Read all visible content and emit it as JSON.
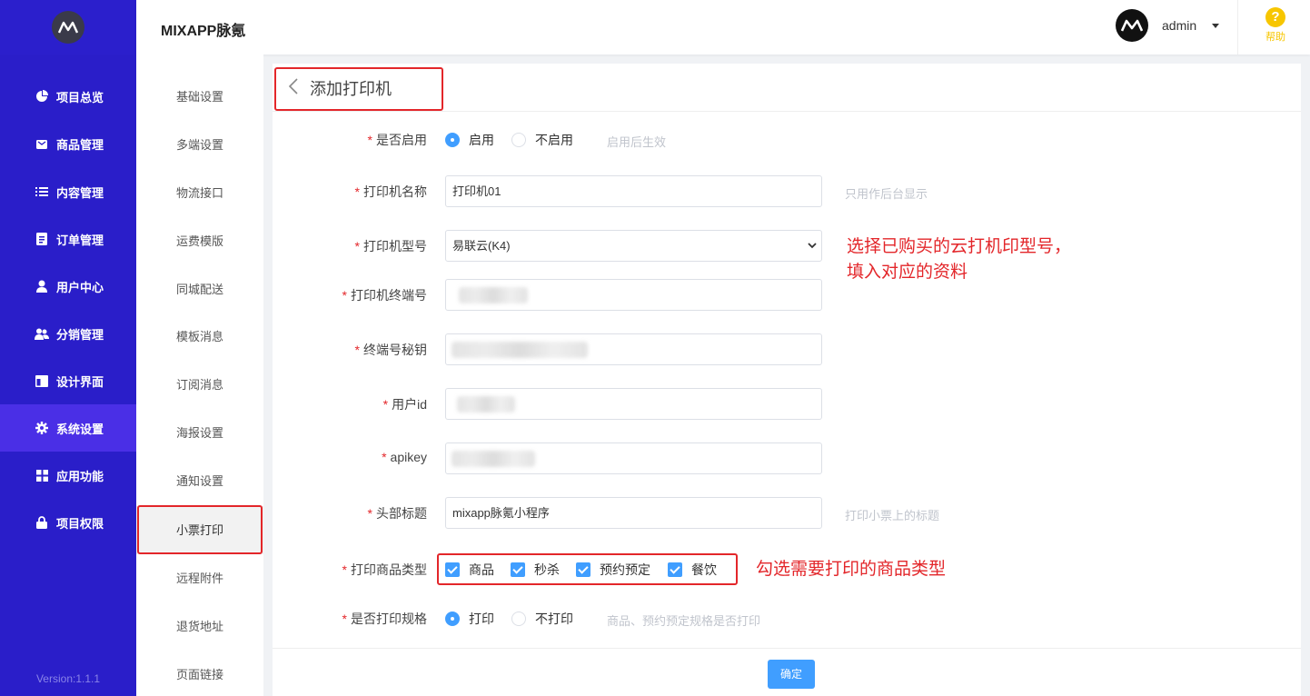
{
  "sidebar": {
    "version": "Version:1.1.1",
    "items": [
      {
        "label": "项目总览",
        "icon": "pie-chart-icon"
      },
      {
        "label": "商品管理",
        "icon": "bag-icon"
      },
      {
        "label": "内容管理",
        "icon": "list-icon"
      },
      {
        "label": "订单管理",
        "icon": "order-icon"
      },
      {
        "label": "用户中心",
        "icon": "user-icon"
      },
      {
        "label": "分销管理",
        "icon": "users-icon"
      },
      {
        "label": "设计界面",
        "icon": "layout-icon"
      },
      {
        "label": "系统设置",
        "icon": "gear-icon"
      },
      {
        "label": "应用功能",
        "icon": "grid-icon"
      },
      {
        "label": "项目权限",
        "icon": "lock-icon"
      }
    ]
  },
  "header": {
    "title": "MIXAPP脉氪",
    "username": "admin",
    "help": "帮助"
  },
  "subnav": {
    "items": [
      "基础设置",
      "多端设置",
      "物流接口",
      "运费模版",
      "同城配送",
      "模板消息",
      "订阅消息",
      "海报设置",
      "通知设置",
      "小票打印",
      "远程附件",
      "退货地址",
      "页面链接"
    ]
  },
  "page": {
    "title": "添加打印机"
  },
  "form": {
    "enable": {
      "label": "是否启用",
      "opt1": "启用",
      "opt2": "不启用",
      "hint": "启用后生效"
    },
    "name": {
      "label": "打印机名称",
      "value": "打印机01",
      "hint": "只用作后台显示"
    },
    "model": {
      "label": "打印机型号",
      "value": "易联云(K4)"
    },
    "terminal": {
      "label": "打印机终端号"
    },
    "secret": {
      "label": "终端号秘钥"
    },
    "userid": {
      "label": "用户id"
    },
    "apikey": {
      "label": "apikey"
    },
    "header_title": {
      "label": "头部标题",
      "value": "mixapp脉氪小程序",
      "hint": "打印小票上的标题"
    },
    "types": {
      "label": "打印商品类型",
      "options": [
        "商品",
        "秒杀",
        "预约预定",
        "餐饮"
      ]
    },
    "spec": {
      "label": "是否打印规格",
      "opt1": "打印",
      "opt2": "不打印",
      "hint": "商品、预约预定规格是否打印"
    }
  },
  "annotations": {
    "model_line1": "选择已购买的云打机印型号，",
    "model_line2": "填入对应的资料",
    "types": "勾选需要打印的商品类型"
  },
  "footer": {
    "confirm": "确定"
  },
  "colors": {
    "sidebar": "#2a1ec9",
    "sidebar_active": "#4a2fe6",
    "primary": "#409eff",
    "annotation_red": "#e3262a",
    "help_yellow": "#f7c600"
  }
}
